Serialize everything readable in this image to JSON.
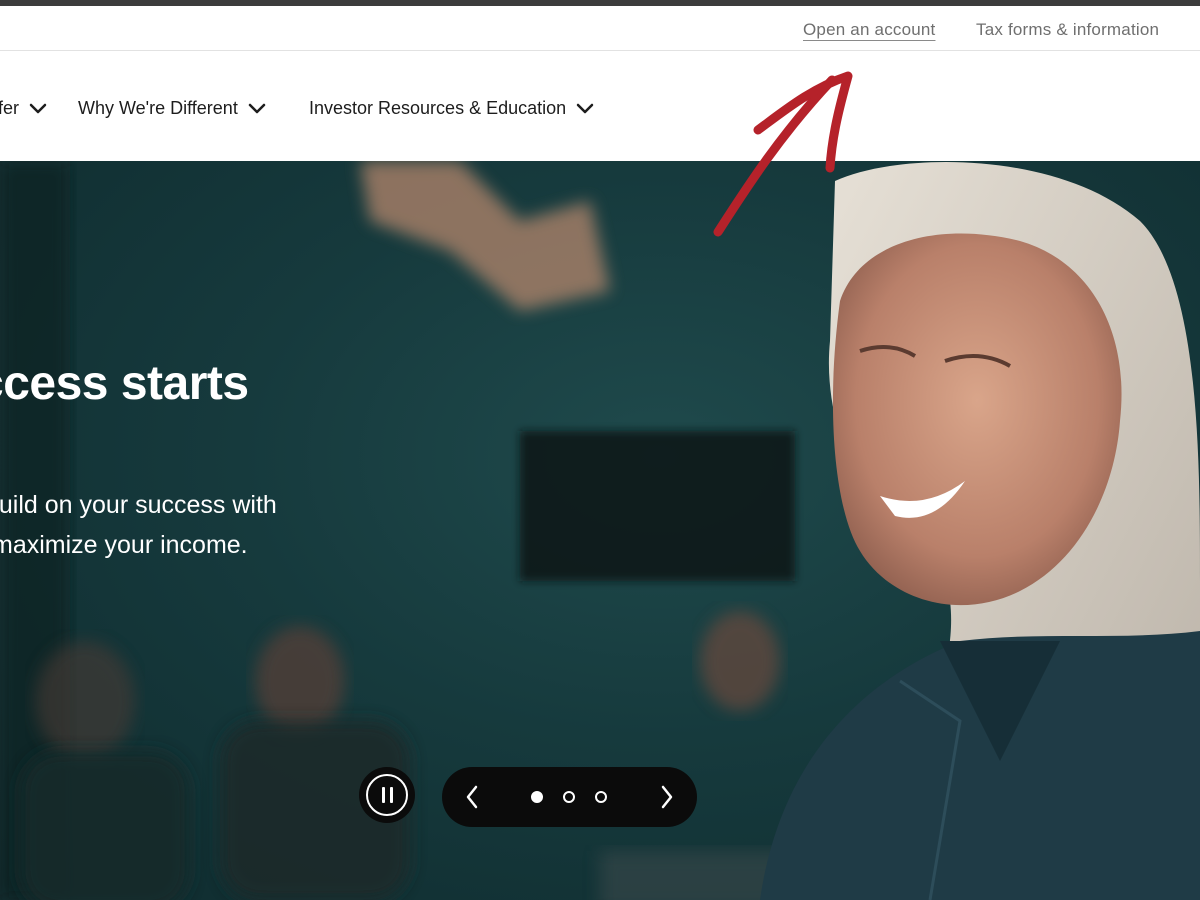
{
  "utility_nav": {
    "open_account": "Open an account",
    "tax_forms": "Tax forms & information"
  },
  "main_nav": {
    "items": [
      {
        "label": "fer",
        "icon": "chevron-down-icon"
      },
      {
        "label": "Why We're Different",
        "icon": "chevron-down-icon"
      },
      {
        "label": "Investor Resources & Education",
        "icon": "chevron-down-icon"
      }
    ]
  },
  "hero": {
    "headline": "success starts",
    "body_line_1": "build on your success with",
    "body_line_2": "maximize your income."
  },
  "carousel": {
    "pause_icon": "pause-icon",
    "prev_icon": "chevron-left-icon",
    "next_icon": "chevron-right-icon",
    "slide_count": 3,
    "active_slide": 1
  },
  "colors": {
    "hero_bg": "#163a3d",
    "annotation_arrow": "#b5222a",
    "control_bg": "#0b0b0b"
  }
}
